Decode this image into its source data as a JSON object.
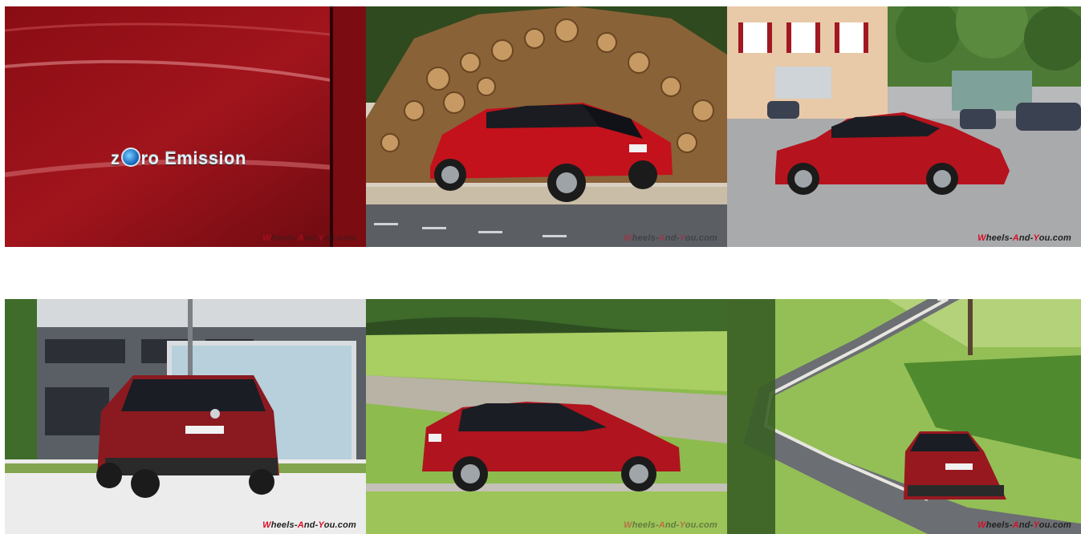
{
  "gallery": {
    "watermark": {
      "brand_w": "W",
      "brand_heels": "heels-",
      "brand_a": "A",
      "brand_nd": "nd-",
      "brand_y": "Y",
      "brand_ou": "ou.com"
    },
    "badge": {
      "prefix": "z",
      "suffix": "ro Emission"
    },
    "photos": [
      {
        "name": "zero-emission-badge-photo"
      },
      {
        "name": "rear-three-quarter-woodpile-photo"
      },
      {
        "name": "side-profile-village-photo"
      },
      {
        "name": "rear-view-office-building-photo"
      },
      {
        "name": "side-profile-meadow-photo"
      },
      {
        "name": "rear-view-country-road-photo"
      }
    ]
  },
  "colors": {
    "car_red": "#b3141e",
    "watermark_red": "#d8102a"
  }
}
